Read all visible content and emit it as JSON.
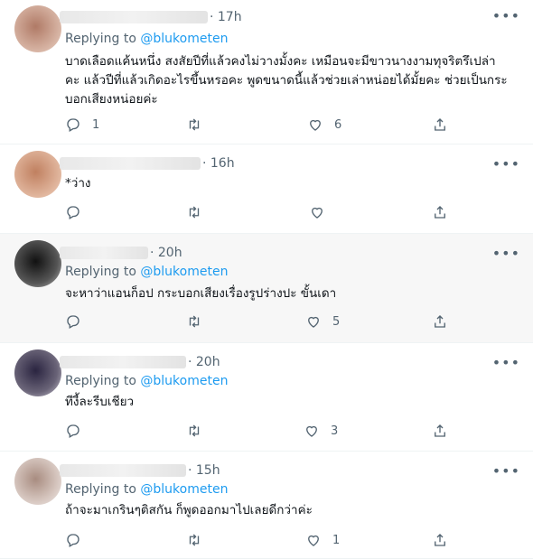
{
  "colors": {
    "accent": "#1d9bf0",
    "muted": "#536471",
    "text": "#0f1419",
    "highlight_bg": "#f7f7f7"
  },
  "tweets": [
    {
      "time": "· 17h",
      "replying_prefix": "Replying to",
      "replying_handle": "@blukometen",
      "lines": [
        "บาดเลือดแค้นหนึ่ง สงสัยปีที่แล้วคงไม่วางมั้งคะ เหมือนจะมีขาวนางงามทุจริตรึเปล่า",
        "คะ แล้วปีที่แล้วเกิดอะไรขึ้นหรอคะ พูดขนาดนี้แล้วช่วยเล่าหน่อยได้มั้ยคะ ช่วยเป็นกระ",
        "บอกเสียงหน่อยค่ะ"
      ],
      "reply_count": "1",
      "retweet_count": "",
      "like_count": "6"
    },
    {
      "time": "· 16h",
      "replying_prefix": "",
      "replying_handle": "",
      "lines": [
        "*ว่าง"
      ],
      "reply_count": "",
      "retweet_count": "",
      "like_count": ""
    },
    {
      "time": "· 20h",
      "replying_prefix": "Replying to",
      "replying_handle": "@blukometen",
      "lines": [
        "จะหาว่าแอนก็อป กระบอกเสียงเรื่องรูปร่างปะ ขั้นเดา"
      ],
      "reply_count": "",
      "retweet_count": "",
      "like_count": "5"
    },
    {
      "time": "· 20h",
      "replying_prefix": "Replying to",
      "replying_handle": "@blukometen",
      "lines": [
        "ทีงี้ละรีบเชียว"
      ],
      "reply_count": "",
      "retweet_count": "",
      "like_count": "3"
    },
    {
      "time": "· 15h",
      "replying_prefix": "Replying to",
      "replying_handle": "@blukometen",
      "lines": [
        "ถ้าจะมาเกรินๆติสกัน ก็พูดออกมาไปเลยดีกว่าค่ะ"
      ],
      "reply_count": "",
      "retweet_count": "",
      "like_count": "1"
    }
  ],
  "icons": {
    "reply": "reply-icon",
    "retweet": "retweet-icon",
    "like": "heart-icon",
    "share": "share-icon",
    "more": "more-icon"
  }
}
